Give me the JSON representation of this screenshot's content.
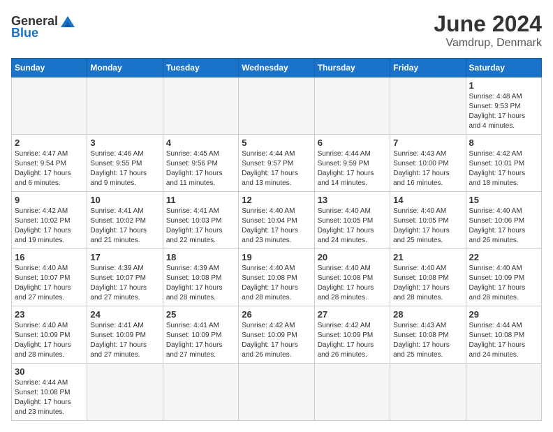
{
  "logo": {
    "text_general": "General",
    "text_blue": "Blue"
  },
  "title": "June 2024",
  "subtitle": "Vamdrup, Denmark",
  "weekdays": [
    "Sunday",
    "Monday",
    "Tuesday",
    "Wednesday",
    "Thursday",
    "Friday",
    "Saturday"
  ],
  "weeks": [
    [
      {
        "day": "",
        "empty": true
      },
      {
        "day": "",
        "empty": true
      },
      {
        "day": "",
        "empty": true
      },
      {
        "day": "",
        "empty": true
      },
      {
        "day": "",
        "empty": true
      },
      {
        "day": "",
        "empty": true
      },
      {
        "day": "1",
        "sunrise": "Sunrise: 4:48 AM",
        "sunset": "Sunset: 9:53 PM",
        "daylight": "Daylight: 17 hours and 4 minutes."
      }
    ],
    [
      {
        "day": "2",
        "sunrise": "Sunrise: 4:47 AM",
        "sunset": "Sunset: 9:54 PM",
        "daylight": "Daylight: 17 hours and 6 minutes."
      },
      {
        "day": "3",
        "sunrise": "Sunrise: 4:46 AM",
        "sunset": "Sunset: 9:55 PM",
        "daylight": "Daylight: 17 hours and 9 minutes."
      },
      {
        "day": "4",
        "sunrise": "Sunrise: 4:45 AM",
        "sunset": "Sunset: 9:56 PM",
        "daylight": "Daylight: 17 hours and 11 minutes."
      },
      {
        "day": "5",
        "sunrise": "Sunrise: 4:44 AM",
        "sunset": "Sunset: 9:57 PM",
        "daylight": "Daylight: 17 hours and 13 minutes."
      },
      {
        "day": "6",
        "sunrise": "Sunrise: 4:44 AM",
        "sunset": "Sunset: 9:59 PM",
        "daylight": "Daylight: 17 hours and 14 minutes."
      },
      {
        "day": "7",
        "sunrise": "Sunrise: 4:43 AM",
        "sunset": "Sunset: 10:00 PM",
        "daylight": "Daylight: 17 hours and 16 minutes."
      },
      {
        "day": "8",
        "sunrise": "Sunrise: 4:42 AM",
        "sunset": "Sunset: 10:01 PM",
        "daylight": "Daylight: 17 hours and 18 minutes."
      }
    ],
    [
      {
        "day": "9",
        "sunrise": "Sunrise: 4:42 AM",
        "sunset": "Sunset: 10:02 PM",
        "daylight": "Daylight: 17 hours and 19 minutes."
      },
      {
        "day": "10",
        "sunrise": "Sunrise: 4:41 AM",
        "sunset": "Sunset: 10:02 PM",
        "daylight": "Daylight: 17 hours and 21 minutes."
      },
      {
        "day": "11",
        "sunrise": "Sunrise: 4:41 AM",
        "sunset": "Sunset: 10:03 PM",
        "daylight": "Daylight: 17 hours and 22 minutes."
      },
      {
        "day": "12",
        "sunrise": "Sunrise: 4:40 AM",
        "sunset": "Sunset: 10:04 PM",
        "daylight": "Daylight: 17 hours and 23 minutes."
      },
      {
        "day": "13",
        "sunrise": "Sunrise: 4:40 AM",
        "sunset": "Sunset: 10:05 PM",
        "daylight": "Daylight: 17 hours and 24 minutes."
      },
      {
        "day": "14",
        "sunrise": "Sunrise: 4:40 AM",
        "sunset": "Sunset: 10:05 PM",
        "daylight": "Daylight: 17 hours and 25 minutes."
      },
      {
        "day": "15",
        "sunrise": "Sunrise: 4:40 AM",
        "sunset": "Sunset: 10:06 PM",
        "daylight": "Daylight: 17 hours and 26 minutes."
      }
    ],
    [
      {
        "day": "16",
        "sunrise": "Sunrise: 4:40 AM",
        "sunset": "Sunset: 10:07 PM",
        "daylight": "Daylight: 17 hours and 27 minutes."
      },
      {
        "day": "17",
        "sunrise": "Sunrise: 4:39 AM",
        "sunset": "Sunset: 10:07 PM",
        "daylight": "Daylight: 17 hours and 27 minutes."
      },
      {
        "day": "18",
        "sunrise": "Sunrise: 4:39 AM",
        "sunset": "Sunset: 10:08 PM",
        "daylight": "Daylight: 17 hours and 28 minutes."
      },
      {
        "day": "19",
        "sunrise": "Sunrise: 4:40 AM",
        "sunset": "Sunset: 10:08 PM",
        "daylight": "Daylight: 17 hours and 28 minutes."
      },
      {
        "day": "20",
        "sunrise": "Sunrise: 4:40 AM",
        "sunset": "Sunset: 10:08 PM",
        "daylight": "Daylight: 17 hours and 28 minutes."
      },
      {
        "day": "21",
        "sunrise": "Sunrise: 4:40 AM",
        "sunset": "Sunset: 10:08 PM",
        "daylight": "Daylight: 17 hours and 28 minutes."
      },
      {
        "day": "22",
        "sunrise": "Sunrise: 4:40 AM",
        "sunset": "Sunset: 10:09 PM",
        "daylight": "Daylight: 17 hours and 28 minutes."
      }
    ],
    [
      {
        "day": "23",
        "sunrise": "Sunrise: 4:40 AM",
        "sunset": "Sunset: 10:09 PM",
        "daylight": "Daylight: 17 hours and 28 minutes."
      },
      {
        "day": "24",
        "sunrise": "Sunrise: 4:41 AM",
        "sunset": "Sunset: 10:09 PM",
        "daylight": "Daylight: 17 hours and 27 minutes."
      },
      {
        "day": "25",
        "sunrise": "Sunrise: 4:41 AM",
        "sunset": "Sunset: 10:09 PM",
        "daylight": "Daylight: 17 hours and 27 minutes."
      },
      {
        "day": "26",
        "sunrise": "Sunrise: 4:42 AM",
        "sunset": "Sunset: 10:09 PM",
        "daylight": "Daylight: 17 hours and 26 minutes."
      },
      {
        "day": "27",
        "sunrise": "Sunrise: 4:42 AM",
        "sunset": "Sunset: 10:09 PM",
        "daylight": "Daylight: 17 hours and 26 minutes."
      },
      {
        "day": "28",
        "sunrise": "Sunrise: 4:43 AM",
        "sunset": "Sunset: 10:08 PM",
        "daylight": "Daylight: 17 hours and 25 minutes."
      },
      {
        "day": "29",
        "sunrise": "Sunrise: 4:44 AM",
        "sunset": "Sunset: 10:08 PM",
        "daylight": "Daylight: 17 hours and 24 minutes."
      }
    ],
    [
      {
        "day": "30",
        "sunrise": "Sunrise: 4:44 AM",
        "sunset": "Sunset: 10:08 PM",
        "daylight": "Daylight: 17 hours and 23 minutes."
      },
      {
        "day": "",
        "empty": true
      },
      {
        "day": "",
        "empty": true
      },
      {
        "day": "",
        "empty": true
      },
      {
        "day": "",
        "empty": true
      },
      {
        "day": "",
        "empty": true
      },
      {
        "day": "",
        "empty": true
      }
    ]
  ]
}
